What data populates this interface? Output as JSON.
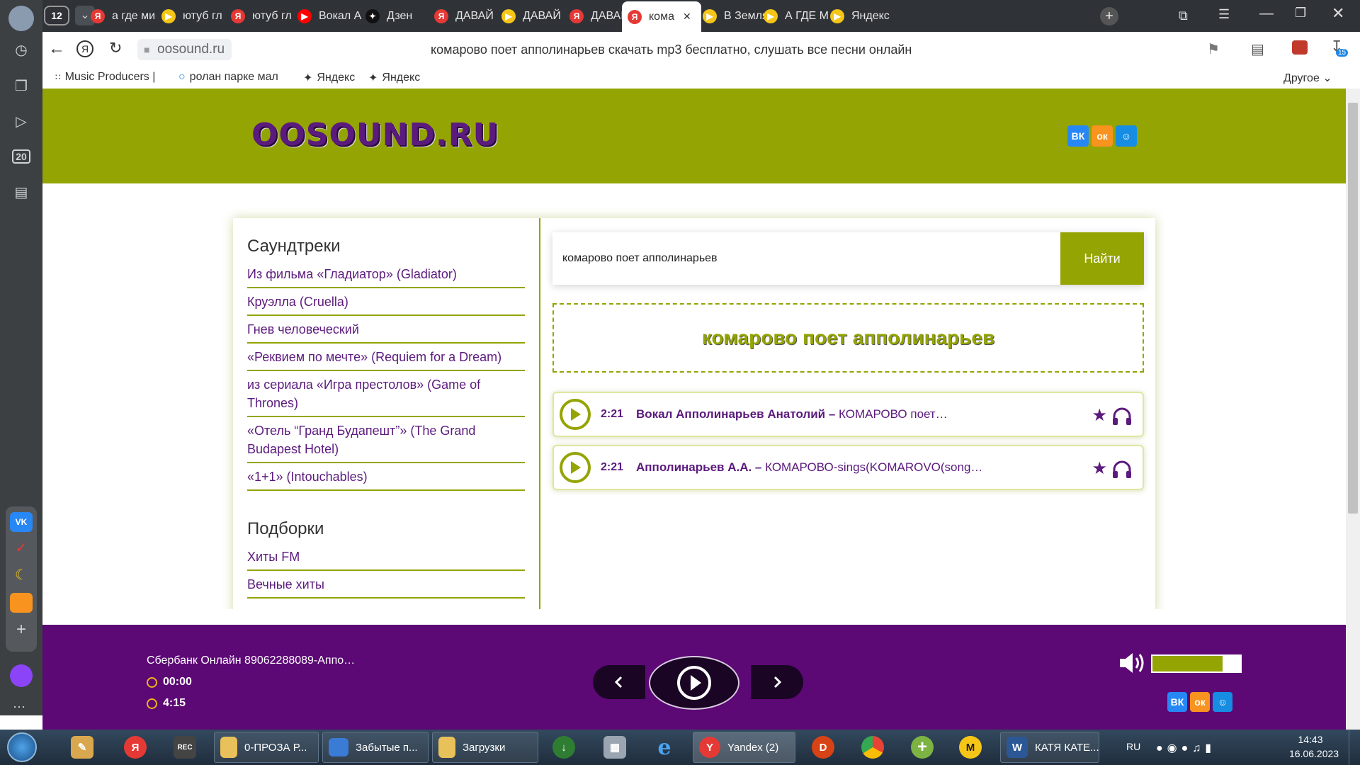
{
  "browser": {
    "tab_count": "12",
    "tabs": [
      {
        "label": "а где ми",
        "icon": "yandex-icon",
        "color": "#e53935"
      },
      {
        "label": "ютуб гл",
        "icon": "yandex-video-icon",
        "color": "#f5c518"
      },
      {
        "label": "ютуб гл",
        "icon": "yandex-icon",
        "color": "#e53935"
      },
      {
        "label": "Вокал А",
        "icon": "youtube-icon",
        "color": "#ff0000"
      },
      {
        "label": "Дзен",
        "icon": "dzen-icon",
        "color": "#111111"
      },
      {
        "label": "ДАВАЙ",
        "icon": "yandex-icon",
        "color": "#e53935"
      },
      {
        "label": "ДАВАЙ",
        "icon": "yandex-video-icon",
        "color": "#f5c518"
      },
      {
        "label": "ДАВАЙ",
        "icon": "yandex-icon",
        "color": "#e53935"
      },
      {
        "label": "кома",
        "icon": "oosound-icon",
        "color": "#e53935"
      },
      {
        "label": "В Земля",
        "icon": "yandex-video-icon",
        "color": "#f5c518"
      },
      {
        "label": "А ГДЕ М",
        "icon": "yandex-video-icon",
        "color": "#f5c518"
      },
      {
        "label": "Яндекс",
        "icon": "yandex-video-icon",
        "color": "#f5c518"
      }
    ],
    "url": "oosound.ru",
    "page_title": "комарово поет апполинарьев скачать mp3 бесплатно, слушать все песни онлайн",
    "downloads_badge": "15",
    "bookmarks": [
      "Music Producers |",
      "ролан парке маль",
      "Яндекс",
      "Яндекс"
    ],
    "bookmarks_other": "Другое",
    "sidebar_badge": "20"
  },
  "site": {
    "logo": "OOSOUND.RU",
    "social": [
      "ВК",
      "ок",
      "☺"
    ]
  },
  "left": {
    "soundtracks_title": "Саундтреки",
    "soundtracks": [
      "Из фильма «Гладиатор» (Gladiator)",
      "Круэлла (Cruella)",
      "Гнев человеческий",
      "«Реквием по мечте» (Requiem for a Dream)",
      "из сериала «Игра престолов» (Game of Thrones)",
      "«Отель “Гранд Будапешт”» (The Grand Budapest Hotel)",
      "«1+1» (Intouchables)"
    ],
    "collections_title": "Подборки",
    "collections": [
      "Хиты FM",
      "Вечные хиты"
    ]
  },
  "search": {
    "value": "комарово поет апполинарьев",
    "button": "Найти"
  },
  "query_title": "комарово поет апполинарьев",
  "tracks": [
    {
      "duration": "2:21",
      "artist": "Вокал Апполинарьев Анатолий –",
      "title": "КОМАРОВО поет…"
    },
    {
      "duration": "2:21",
      "artist": "Апполинарьев А.А. –",
      "title": "КОМАРОВО-sings(KOMAROVO(song…"
    }
  ],
  "player": {
    "title": "Сбербанк Онлайн 89062288089-Аппо…",
    "current_time": "00:00",
    "total_time": "4:15",
    "volume": 0.8,
    "accent": "#94a402",
    "background": "#5c0875"
  },
  "taskbar": {
    "windows": [
      "0-ПРОЗА Р...",
      "Забытые п...",
      "Загрузки",
      "Yandex (2)",
      "КАТЯ КАТЕ..."
    ],
    "lang": "RU",
    "time": "14:43",
    "date": "16.06.2023"
  }
}
